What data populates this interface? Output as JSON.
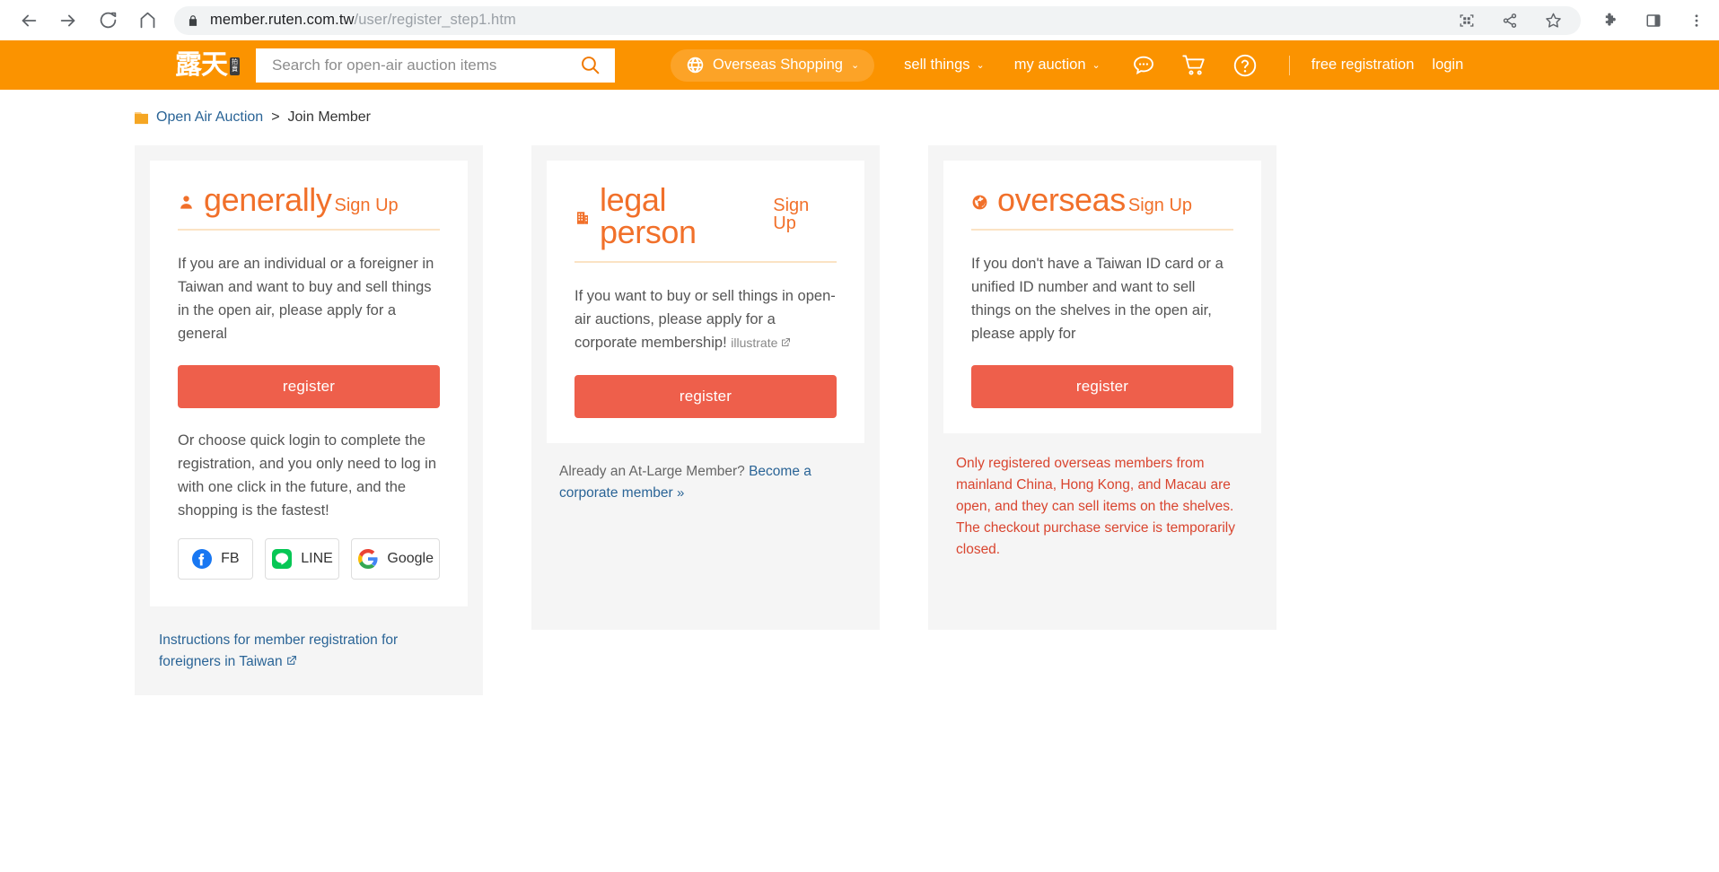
{
  "browser": {
    "url_host": "member.ruten.com.tw",
    "url_path": "/user/register_step1.htm",
    "back_icon": "back-arrow-icon",
    "forward_icon": "forward-arrow-icon",
    "reload_icon": "reload-icon",
    "home_icon": "home-icon",
    "lock_icon": "lock-icon",
    "qr_icon": "qr-code-icon",
    "share_icon": "share-icon",
    "bookmark_icon": "star-icon",
    "extensions_icon": "puzzle-piece-icon",
    "sidepanel_icon": "side-panel-icon",
    "menu_icon": "three-dot-menu-icon"
  },
  "header": {
    "logo_text": "露天",
    "logo_badge_line1": "拍",
    "logo_badge_line2": "賣",
    "search_placeholder": "Search for open-air auction items",
    "search_value": "",
    "overseas_label": "Overseas Shopping",
    "sell_label": "sell things",
    "auction_label": "my auction",
    "caret": "⌄",
    "chat_icon": "chat-bubble-icon",
    "cart_icon": "shopping-cart-icon",
    "help_icon": "question-mark-icon",
    "free_registration": "free registration",
    "login": "login",
    "bg_color": "#fb9300"
  },
  "breadcrumb": {
    "home_label": "Open Air Auction",
    "separator": ">",
    "current": "Join Member"
  },
  "cards": {
    "general": {
      "icon": "person-icon",
      "title": "generally",
      "subtitle": "Sign Up",
      "description": "If you are an individual or a foreigner in Taiwan and want to buy and sell things in the open air, please apply for a general",
      "register_label": "register",
      "description2": "Or choose quick login to complete the registration, and you only need to log in with one click in the future, and the shopping is the fastest!",
      "social": [
        {
          "label": "FB",
          "icon": "facebook-icon"
        },
        {
          "label": "LINE",
          "icon": "line-icon"
        },
        {
          "label": "Google",
          "icon": "google-icon"
        }
      ],
      "foreign_note": "Instructions for member registration for foreigners in Taiwan"
    },
    "legal": {
      "icon": "building-icon",
      "title": "legal person",
      "subtitle": "Sign Up",
      "description": "If you want to buy or sell things in open-air auctions, please apply for a corporate membership!",
      "illustrate_link": "illustrate",
      "register_label": "register",
      "note_prefix": "Already an At-Large Member?",
      "note_link": "Become a corporate member",
      "note_chevron": "»"
    },
    "overseas": {
      "icon": "globe-icon",
      "title": "overseas",
      "subtitle": "Sign Up",
      "description": "If you don't have a Taiwan ID card or a unified ID number and want to sell things on the shelves in the open air, please apply for",
      "register_label": "register",
      "warning": "Only registered overseas members from mainland China, Hong Kong, and Macau are open, and they can sell items on the shelves. The checkout purchase service is temporarily closed."
    }
  },
  "colors": {
    "brand_orange": "#fb9300",
    "title_orange": "#f1702a",
    "register_red": "#ee5f4b",
    "link_blue": "#2a6496",
    "warning_red": "#d9452f"
  }
}
